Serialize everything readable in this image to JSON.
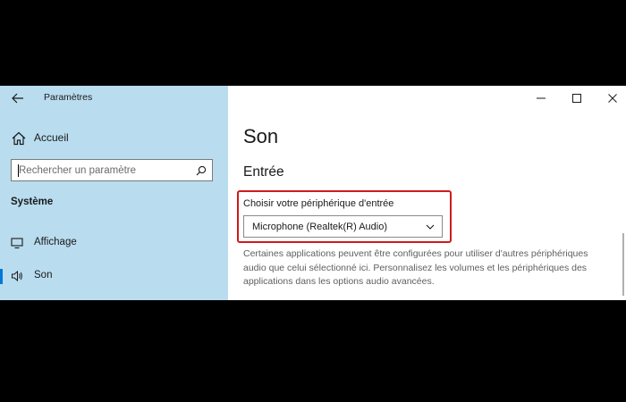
{
  "window": {
    "app_title": "Paramètres",
    "controls": {
      "minimize": "minimize",
      "maximize": "maximize",
      "close": "close"
    }
  },
  "sidebar": {
    "back_icon": "back-arrow-icon",
    "home": {
      "label": "Accueil",
      "icon": "home-icon"
    },
    "search": {
      "placeholder": "Rechercher un paramètre",
      "value": ""
    },
    "section_heading": "Système",
    "items": [
      {
        "label": "Affichage",
        "icon": "display-icon",
        "selected": false
      },
      {
        "label": "Son",
        "icon": "speaker-icon",
        "selected": true
      }
    ]
  },
  "main": {
    "title": "Son",
    "section": "Entrée",
    "input_device": {
      "label": "Choisir votre périphérique d'entrée",
      "selected": "Microphone (Realtek(R) Audio)"
    },
    "description": "Certaines applications peuvent être configurées pour utiliser d'autres périphériques audio que celui sélectionné ici. Personnalisez les volumes et les périphériques des applications dans les options audio avancées."
  },
  "colors": {
    "sidebar_bg": "#b9dcef",
    "accent": "#0078d7",
    "highlight": "#d11a1a",
    "letterbox": "#000000"
  }
}
